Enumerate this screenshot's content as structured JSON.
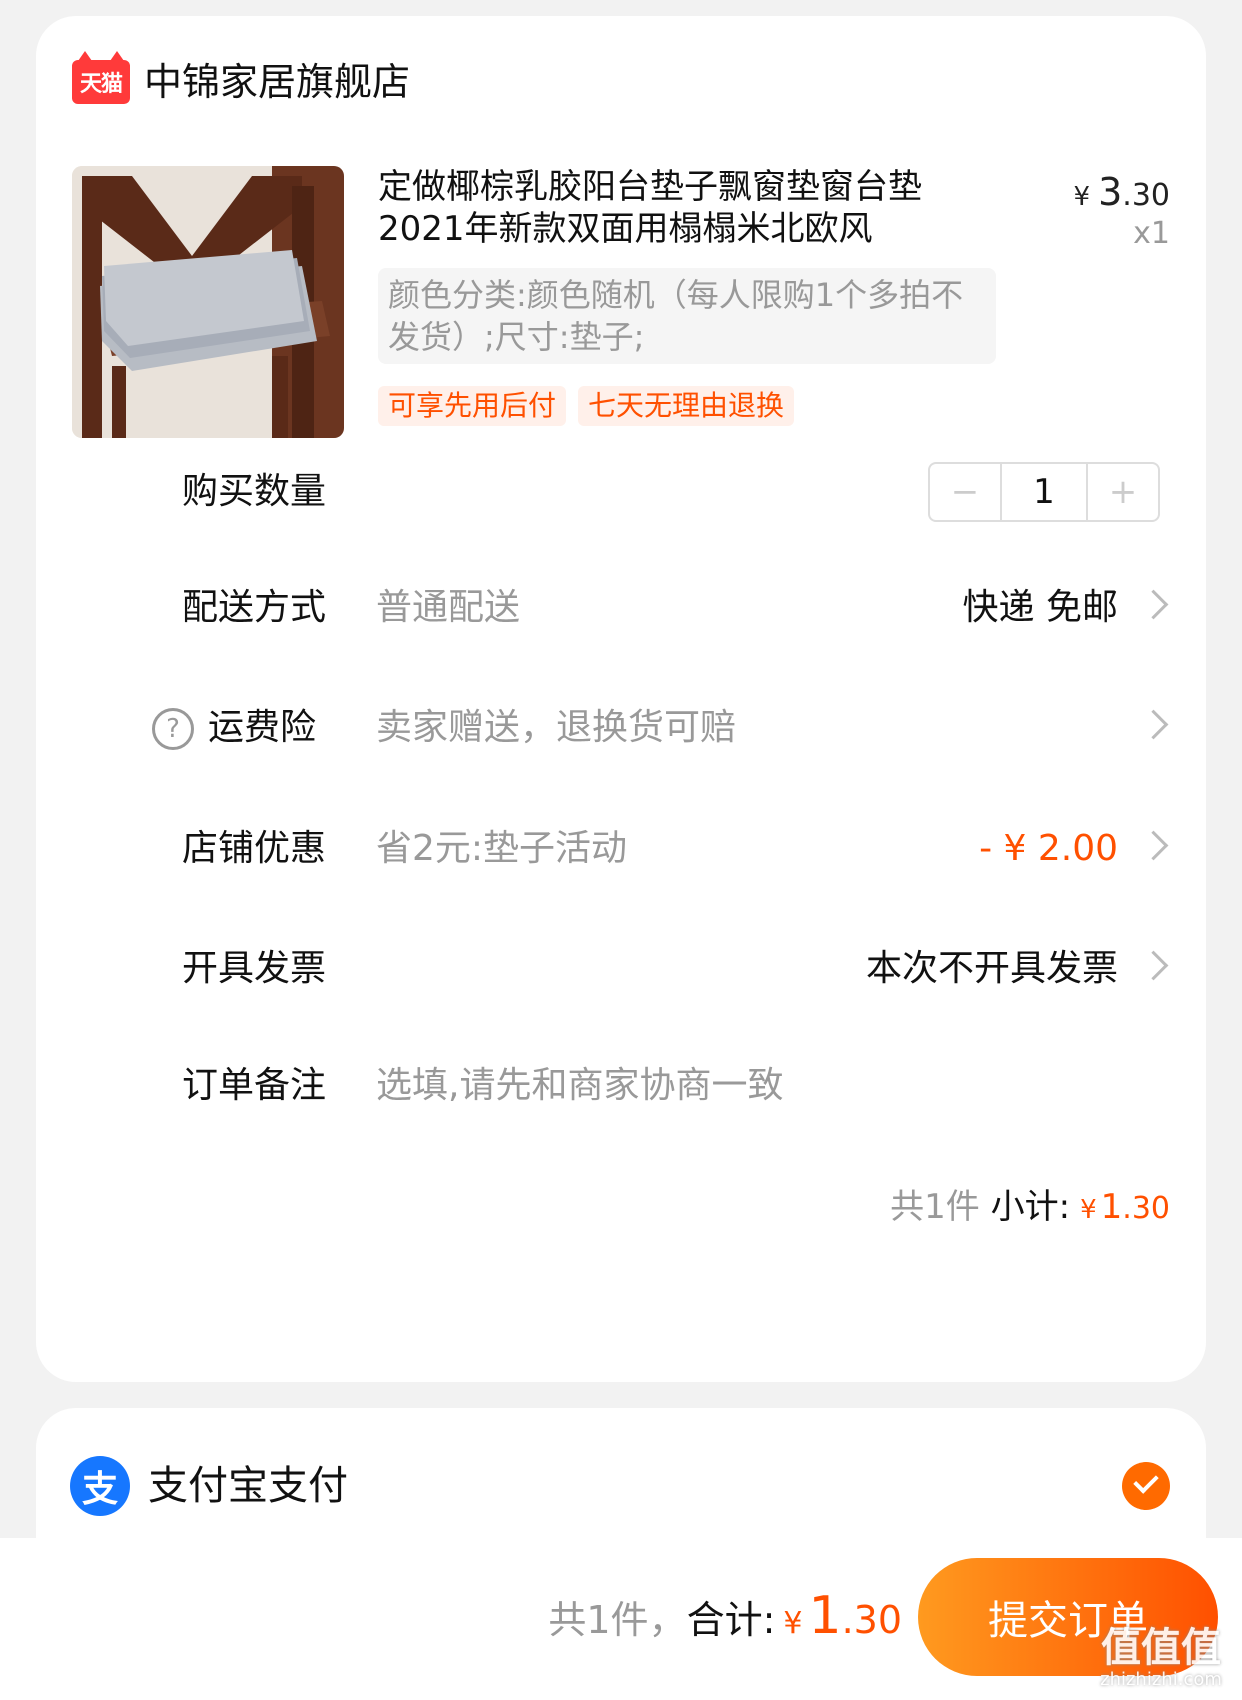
{
  "shop": {
    "badge": "天猫",
    "name": "中锦家居旗舰店"
  },
  "product": {
    "title": "定做椰棕乳胶阳台垫子飘窗垫窗台垫2021年新款双面用榻榻米北欧风",
    "price_currency": "¥",
    "price_int": "3",
    "price_dec": ".30",
    "quantity_label": "x1",
    "spec": "颜色分类:颜色随机（每人限购1个多拍不发货）;尺寸:垫子;",
    "tags": [
      "可享先用后付",
      "七天无理由退换"
    ]
  },
  "quantity": {
    "label": "购买数量",
    "minus": "−",
    "value": "1",
    "plus": "+"
  },
  "delivery": {
    "label": "配送方式",
    "value": "普通配送",
    "right": "快递 免邮"
  },
  "shipping_insurance": {
    "icon": "?",
    "label": "运费险",
    "value": "卖家赠送，退换货可赔"
  },
  "shop_discount": {
    "label": "店铺优惠",
    "value": "省2元:垫子活动",
    "amount": "- ¥ 2.00"
  },
  "invoice": {
    "label": "开具发票",
    "right": "本次不开具发票"
  },
  "remark": {
    "label": "订单备注",
    "placeholder": "选填,请先和商家协商一致"
  },
  "subtotal": {
    "count": "共1件",
    "label": "小计:",
    "currency": "¥",
    "int": "1",
    "dec": ".30"
  },
  "payment": {
    "icon": "支",
    "name": "支付宝支付"
  },
  "footer": {
    "count": "共1件，",
    "label": "合计:",
    "currency": "¥",
    "int": "1",
    "dec": ".30",
    "submit": "提交订单"
  },
  "watermark": {
    "main": "值值值",
    "sub": "zhizhizhi.com"
  },
  "colors": {
    "accent": "#ff5000",
    "tmall": "#ff3a3a",
    "alipay": "#1677ff"
  }
}
